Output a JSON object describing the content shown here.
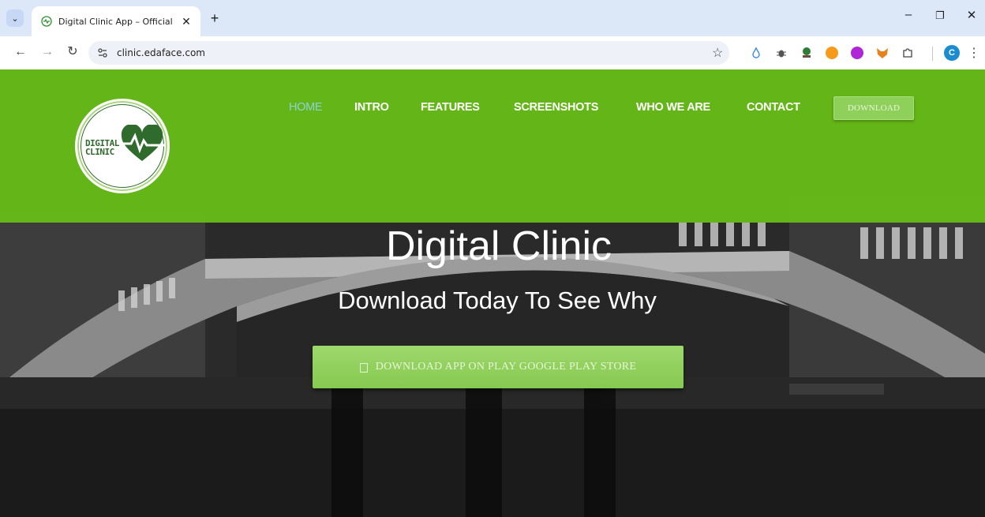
{
  "browser": {
    "tab_title": "Digital Clinic App – Official Web",
    "url": "clinic.edaface.com",
    "profile_initial": "C"
  },
  "site": {
    "logo_text_line1": "DIGITAL",
    "logo_text_line2": "CLINIC",
    "nav": [
      {
        "label": "HOME",
        "active": true
      },
      {
        "label": "INTRO"
      },
      {
        "label": "FEATURES"
      },
      {
        "label": "SCREENSHOTS"
      },
      {
        "label": "WHO WE ARE"
      },
      {
        "label": "CONTACT"
      }
    ],
    "download_button": "DOWNLOAD"
  },
  "hero": {
    "title": "Digital Clinic",
    "subtitle": "Download Today To See Why",
    "cta": "DOWNLOAD APP ON PLAY GOOGLE PLAY STORE"
  },
  "colors": {
    "brand_green": "#68c016",
    "nav_active": "#8fd0d8",
    "cta_green": "#8ed05a"
  }
}
